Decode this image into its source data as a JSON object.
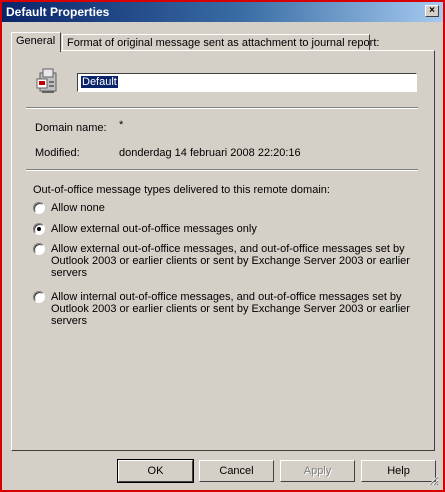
{
  "window": {
    "title": "Default Properties"
  },
  "tabs": [
    {
      "label": "General",
      "active": true
    },
    {
      "label": "Format of original message sent as attachment to journal report:",
      "active": false
    }
  ],
  "general": {
    "name_value": "Default",
    "domain_name_label": "Domain name:",
    "domain_name_value": "*",
    "modified_label": "Modified:",
    "modified_value": "donderdag 14 februari 2008 22:20:16",
    "ooo_heading": "Out-of-office message types delivered to this remote domain:",
    "options": [
      {
        "label": "Allow none",
        "checked": false
      },
      {
        "label": "Allow external out-of-office messages only",
        "checked": true
      },
      {
        "label": "Allow external out-of-office messages, and out-of-office messages set by Outlook 2003 or earlier clients or sent by Exchange Server 2003 or earlier servers",
        "checked": false
      },
      {
        "label": "Allow internal out-of-office messages, and out-of-office messages set by Outlook 2003 or earlier clients or sent by Exchange Server 2003 or earlier servers",
        "checked": false
      }
    ]
  },
  "buttons": {
    "ok": "OK",
    "cancel": "Cancel",
    "apply": "Apply",
    "help": "Help"
  },
  "colors": {
    "title_bar": "#0a246a",
    "face": "#d4d0c8",
    "frame_highlight": "#d80000"
  },
  "icons": [
    "remote-domain-icon",
    "close-icon",
    "radio-icon",
    "size-grip-icon"
  ]
}
